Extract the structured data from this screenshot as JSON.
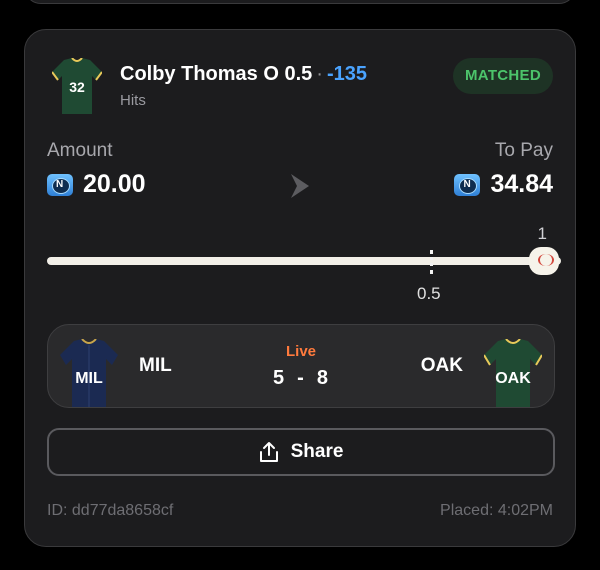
{
  "bet": {
    "player": "Colby Thomas O 0.5",
    "separator": "·",
    "odds": "-135",
    "market": "Hits",
    "status": "MATCHED",
    "jersey_number": "32"
  },
  "stake": {
    "amount_label": "Amount",
    "amount": "20.00",
    "to_pay_label": "To Pay",
    "to_pay": "34.84",
    "coin_icon": "coin-icon",
    "coin_glyph": "N"
  },
  "slider": {
    "max_label": "1",
    "line_label": "0.5",
    "line_value": 0.5,
    "max_value": 1,
    "current_value": 1
  },
  "game": {
    "home_team": "MIL",
    "away_team": "OAK",
    "status": "Live",
    "home_score": "5",
    "score_sep": "-",
    "away_score": "8"
  },
  "share": {
    "label": "Share"
  },
  "footer": {
    "id_text": "ID: dd77da8658cf",
    "placed_text": "Placed: 4:02PM"
  },
  "colors": {
    "background": "#000000",
    "card": "#1c1c1e",
    "odds_blue": "#4aa3ff",
    "matched_green": "#4cc46b",
    "live_orange": "#ff7a3d",
    "mil_navy": "#1b2a52",
    "oak_green": "#1f4a33"
  }
}
